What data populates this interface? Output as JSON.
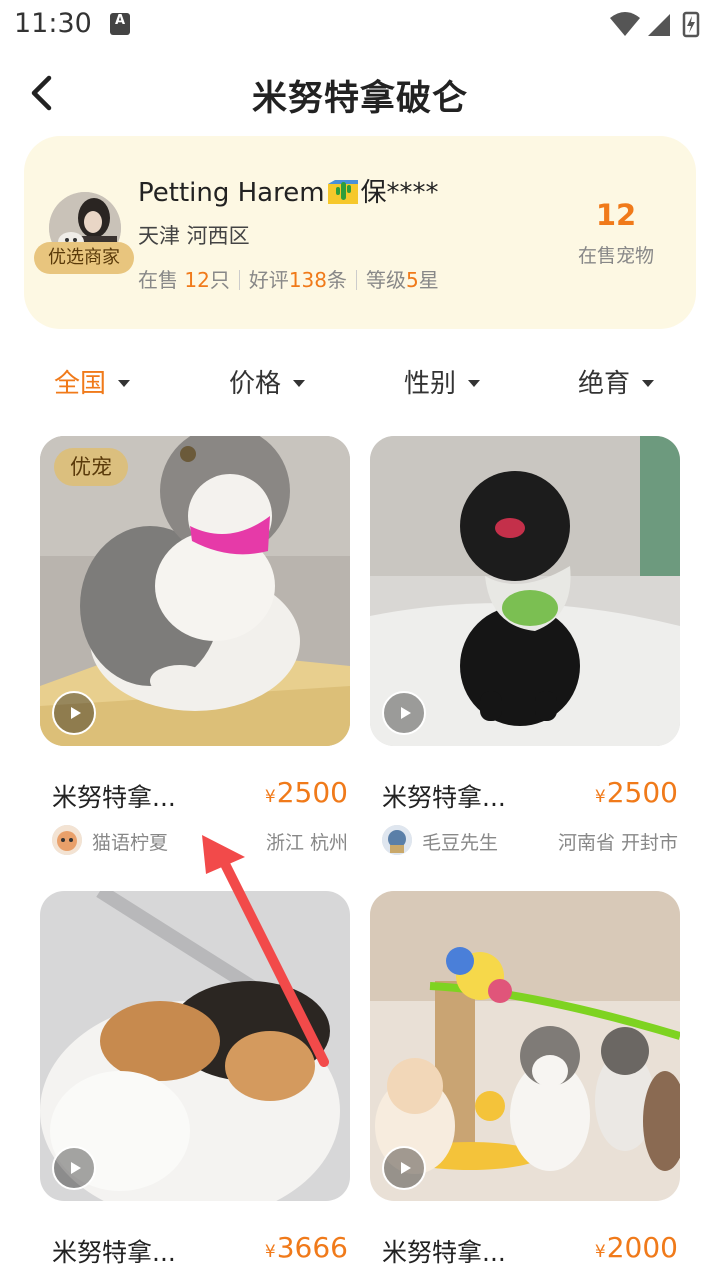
{
  "status_bar": {
    "time": "11:30",
    "notification_icon": "a-icon",
    "icons": [
      "wifi-icon",
      "signal-icon",
      "battery-charging-icon"
    ]
  },
  "nav": {
    "back_icon": "chevron-left-icon",
    "title": "米努特拿破仑"
  },
  "seller": {
    "name_prefix": "Petting Harem",
    "name_suffix": "保****",
    "name_flag_icon": "cactus-flag-icon",
    "badge": "优选商家",
    "location": "天津 河西区",
    "stats": {
      "on_sale_label": "在售",
      "on_sale_value": "12",
      "on_sale_unit": "只",
      "reviews_label": "好评",
      "reviews_value": "138",
      "reviews_unit": "条",
      "level_label": "等级",
      "level_value": "5",
      "level_unit": "星"
    },
    "count": "12",
    "count_label": "在售宠物"
  },
  "filters": [
    {
      "label": "全国",
      "active": true
    },
    {
      "label": "价格",
      "active": false
    },
    {
      "label": "性别",
      "active": false
    },
    {
      "label": "绝育",
      "active": false
    }
  ],
  "listings": [
    {
      "badge": "优宠",
      "title": "米努特拿...",
      "currency": "¥",
      "price": "2500",
      "seller": "猫语柠夏",
      "location": "浙江 杭州"
    },
    {
      "badge": "",
      "title": "米努特拿...",
      "currency": "¥",
      "price": "2500",
      "seller": "毛豆先生",
      "location": "河南省 开封市"
    },
    {
      "badge": "",
      "title": "米努特拿...",
      "currency": "¥",
      "price": "3666",
      "seller": "",
      "location": ""
    },
    {
      "badge": "",
      "title": "米努特拿...",
      "currency": "¥",
      "price": "2000",
      "seller": "",
      "location": ""
    }
  ],
  "colors": {
    "accent": "#f07a1a",
    "card_bg": "#fdf8e3",
    "badge_bg": "#e8c57e",
    "annotation_arrow": "#f24a4a"
  }
}
